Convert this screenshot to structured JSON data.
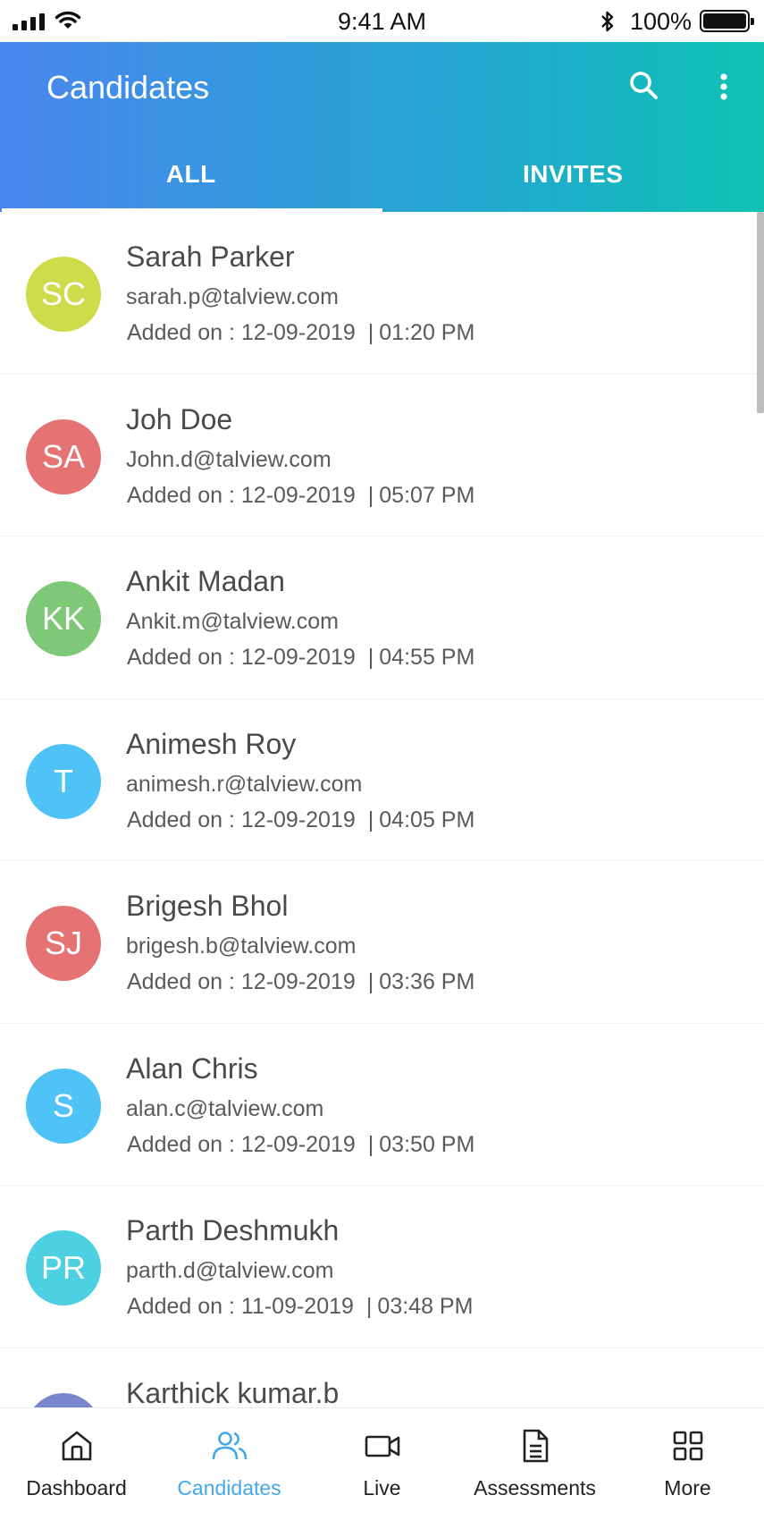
{
  "status_bar": {
    "time": "9:41 AM",
    "battery": "100%"
  },
  "header": {
    "title": "Candidates"
  },
  "tabs": [
    {
      "label": "ALL"
    },
    {
      "label": "INVITES"
    }
  ],
  "candidates": [
    {
      "initials": "SC",
      "name": "Sarah Parker",
      "email": "sarah.p@talview.com",
      "added_label": "Added on :",
      "date": "12-09-2019",
      "time": "01:20 PM",
      "color": "#cddc4a"
    },
    {
      "initials": "SA",
      "name": "Joh Doe",
      "email": "John.d@talview.com",
      "added_label": "Added on :",
      "date": "12-09-2019",
      "time": "05:07 PM",
      "color": "#e57373"
    },
    {
      "initials": "KK",
      "name": "Ankit Madan",
      "email": "Ankit.m@talview.com",
      "added_label": "Added on :",
      "date": "12-09-2019",
      "time": "04:55 PM",
      "color": "#7ec878"
    },
    {
      "initials": "T",
      "name": "Animesh Roy",
      "email": "animesh.r@talview.com",
      "added_label": "Added on :",
      "date": "12-09-2019",
      "time": "04:05 PM",
      "color": "#4fc3f7"
    },
    {
      "initials": "SJ",
      "name": "Brigesh Bhol",
      "email": "brigesh.b@talview.com",
      "added_label": "Added on :",
      "date": "12-09-2019",
      "time": "03:36 PM",
      "color": "#e57373"
    },
    {
      "initials": "S",
      "name": "Alan Chris",
      "email": "alan.c@talview.com",
      "added_label": "Added on :",
      "date": "12-09-2019",
      "time": "03:50 PM",
      "color": "#4fc3f7"
    },
    {
      "initials": "PR",
      "name": "Parth Deshmukh",
      "email": "parth.d@talview.com",
      "added_label": "Added on :",
      "date": "11-09-2019",
      "time": "03:48 PM",
      "color": "#4dd0e1"
    },
    {
      "initials": "",
      "name": "Karthick kumar.b",
      "email": "",
      "added_label": "",
      "date": "",
      "time": "",
      "color": "#7986cb"
    }
  ],
  "bottom_nav": [
    {
      "label": "Dashboard",
      "icon": "home-icon"
    },
    {
      "label": "Candidates",
      "icon": "users-icon"
    },
    {
      "label": "Live",
      "icon": "video-camera-icon"
    },
    {
      "label": "Assessments",
      "icon": "document-icon"
    },
    {
      "label": "More",
      "icon": "grid-icon"
    }
  ],
  "colors": {
    "accent": "#45a8e8",
    "header_start": "#4a86ef",
    "header_end": "#10c3b4"
  }
}
